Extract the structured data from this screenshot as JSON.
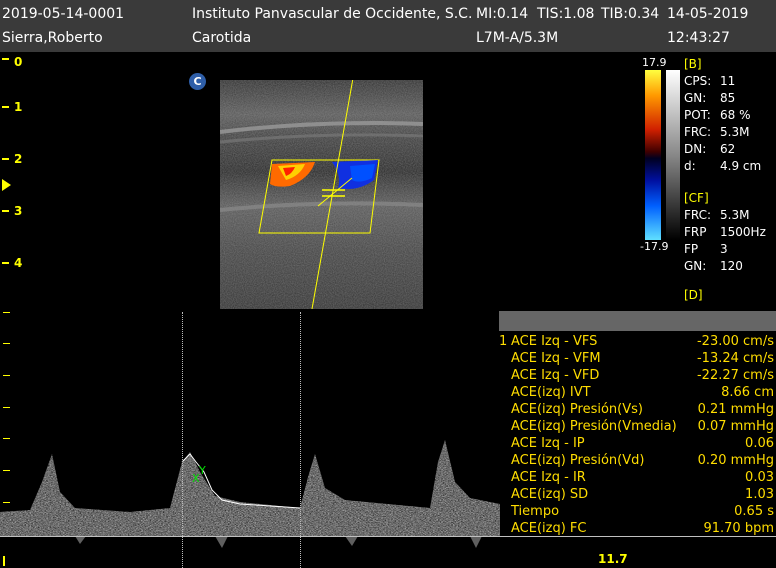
{
  "header": {
    "patient_id": "2019-05-14-0001",
    "patient_name": "Sierra,Roberto",
    "institution": "Instituto Panvascular de Occidente, S.C.",
    "mi": "MI:0.14",
    "tis": "TIS:1.08",
    "tib": "TIB:0.34",
    "date": "14-05-2019",
    "exam": "Carotida",
    "probe": "L7M-A/5.3M",
    "time": "12:43:27"
  },
  "depth_scale": [
    "0",
    "1",
    "2",
    "3",
    "4"
  ],
  "orientation_badge": "C",
  "color_bar": {
    "max": "17.9",
    "min": "-17.9"
  },
  "params": {
    "b_header": "[B]",
    "b": [
      {
        "key": "CPS:",
        "value": "11"
      },
      {
        "key": "GN:",
        "value": "85"
      },
      {
        "key": "POT:",
        "value": "68 %"
      },
      {
        "key": "FRC:",
        "value": "5.3M"
      },
      {
        "key": "DN:",
        "value": "62"
      },
      {
        "key": "d:",
        "value": "4.9 cm"
      }
    ],
    "cf_header": "[CF]",
    "cf": [
      {
        "key": "FRC:",
        "value": "5.3M"
      },
      {
        "key": "FRP",
        "value": "1500Hz"
      },
      {
        "key": "FP",
        "value": "3"
      },
      {
        "key": "GN:",
        "value": "120"
      }
    ],
    "d_header": "[D]"
  },
  "doppler": {
    "scale_value": "11.7"
  },
  "measurements": {
    "index": "1",
    "rows": [
      {
        "label": "ACE Izq - VFS",
        "value": "-23.00 cm/s"
      },
      {
        "label": "ACE Izq - VFM",
        "value": "-13.24 cm/s"
      },
      {
        "label": "ACE Izq - VFD",
        "value": "-22.27 cm/s"
      },
      {
        "label": "ACE(izq) IVT",
        "value": "8.66 cm"
      },
      {
        "label": "ACE(izq) Presión(Vs)",
        "value": "0.21 mmHg"
      },
      {
        "label": "ACE(izq) Presión(Vmedia)",
        "value": "0.07 mmHg"
      },
      {
        "label": "ACE Izq - IP",
        "value": "0.06"
      },
      {
        "label": "ACE(izq) Presión(Vd)",
        "value": "0.20 mmHg"
      },
      {
        "label": "ACE Izq - IR",
        "value": "0.03"
      },
      {
        "label": "ACE(izq) SD",
        "value": "1.03"
      },
      {
        "label": "Tiempo",
        "value": "0.65 s"
      },
      {
        "label": "ACE(izq) FC",
        "value": "91.70 bpm"
      }
    ]
  },
  "colors": {
    "header_bg": "#3a3a3a",
    "scale_yellow": "#ffff00",
    "measurement_text": "#ffdd00",
    "measurement_header": "#666666"
  }
}
